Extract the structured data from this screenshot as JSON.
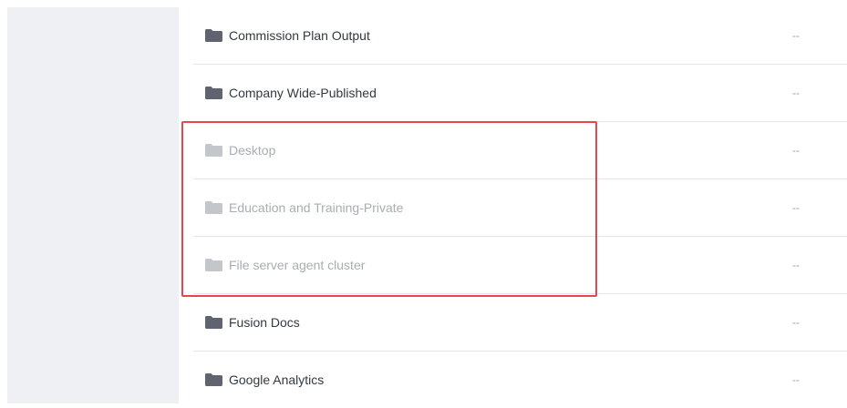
{
  "folders": [
    {
      "name": "Commission Plan Output",
      "value": "--",
      "state": "enabled"
    },
    {
      "name": "Company Wide-Published",
      "value": "--",
      "state": "enabled"
    },
    {
      "name": "Desktop",
      "value": "--",
      "state": "disabled"
    },
    {
      "name": "Education and Training-Private",
      "value": "--",
      "state": "disabled"
    },
    {
      "name": "File server agent cluster",
      "value": "--",
      "state": "disabled"
    },
    {
      "name": "Fusion Docs",
      "value": "--",
      "state": "enabled"
    },
    {
      "name": "Google Analytics",
      "value": "--",
      "state": "enabled"
    }
  ],
  "icons": {
    "folder": "folder-icon"
  },
  "colors": {
    "folder_enabled": "#5f6470",
    "folder_disabled": "#c3c7cc",
    "highlight": "#e5474b",
    "sidebar": "#eef0f3"
  }
}
